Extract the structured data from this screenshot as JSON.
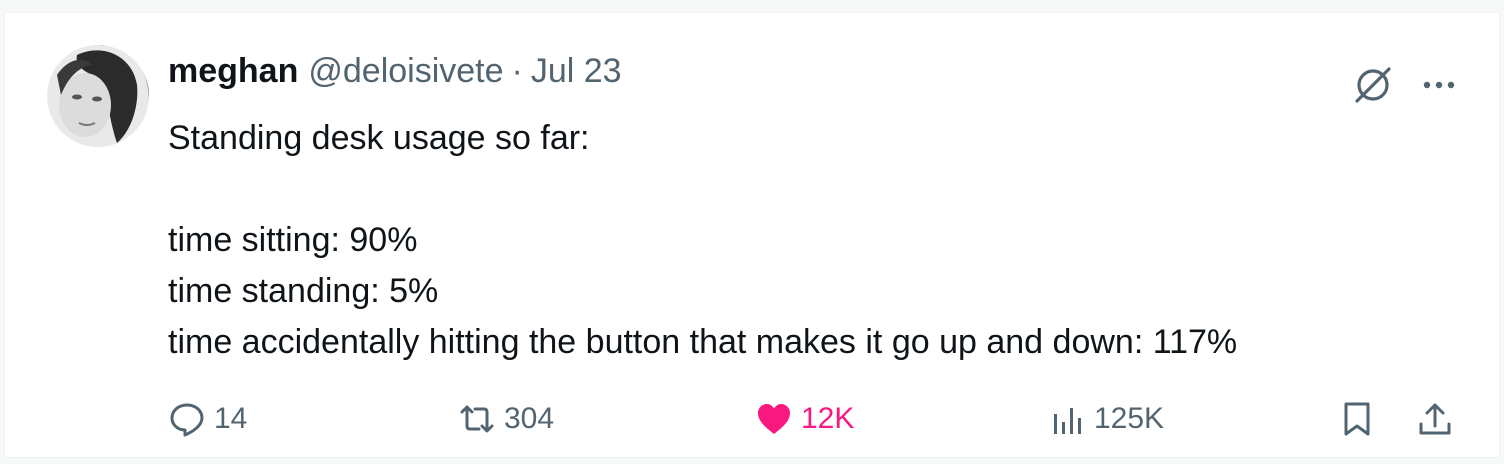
{
  "tweet": {
    "display_name": "meghan",
    "handle": "@deloisivete",
    "separator": "·",
    "date": "Jul 23",
    "text": "Standing desk usage so far:\n\ntime sitting: 90%\ntime standing: 5%\ntime accidentally hitting the button that makes it go up and down: 117%"
  },
  "actions": {
    "reply_count": "14",
    "repost_count": "304",
    "like_count": "12K",
    "view_count": "125K"
  },
  "colors": {
    "text": "#0f1419",
    "secondary": "#536471",
    "like": "#f91880",
    "border": "#eff3f4"
  },
  "icons": [
    "avatar",
    "grok-icon",
    "more-icon",
    "reply-icon",
    "repost-icon",
    "heart-icon",
    "views-icon",
    "bookmark-icon",
    "share-icon"
  ]
}
